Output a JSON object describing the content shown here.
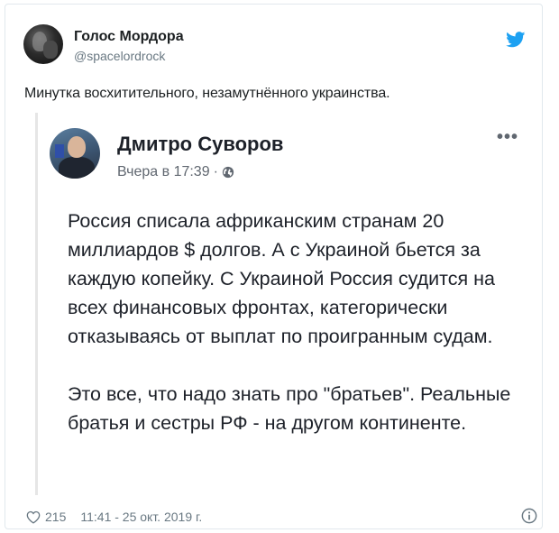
{
  "tweet": {
    "author_name": "Голос Мордора",
    "author_handle": "@spacelordrock",
    "text": "Минутка восхитительного, незамутнённого украинства.",
    "likes": "215",
    "timestamp": "11:41 - 25 окт. 2019 г.",
    "icons": {
      "brand": "twitter-bird-icon",
      "like": "heart-icon",
      "info": "info-icon"
    },
    "colors": {
      "brand": "#1da1f2",
      "secondary_text": "#697882"
    }
  },
  "embedded_post": {
    "author_name": "Дмитро Суворов",
    "time": "Вчера в 17:39",
    "separator": "·",
    "visibility_icon": "globe-icon",
    "more_icon": "more-options-icon",
    "more_label": "•••",
    "paragraph_1": "Россия списала африканским странам 20 миллиардов $ долгов. А с Украиной бьется за каждую копейку. С Украиной Россия судится на всех финансовых фронтах, категорически отказываясь от выплат по проигранным судам.",
    "paragraph_2": "Это все, что надо знать про \"братьев\". Реальные братья и сестры РФ - на другом континенте."
  }
}
